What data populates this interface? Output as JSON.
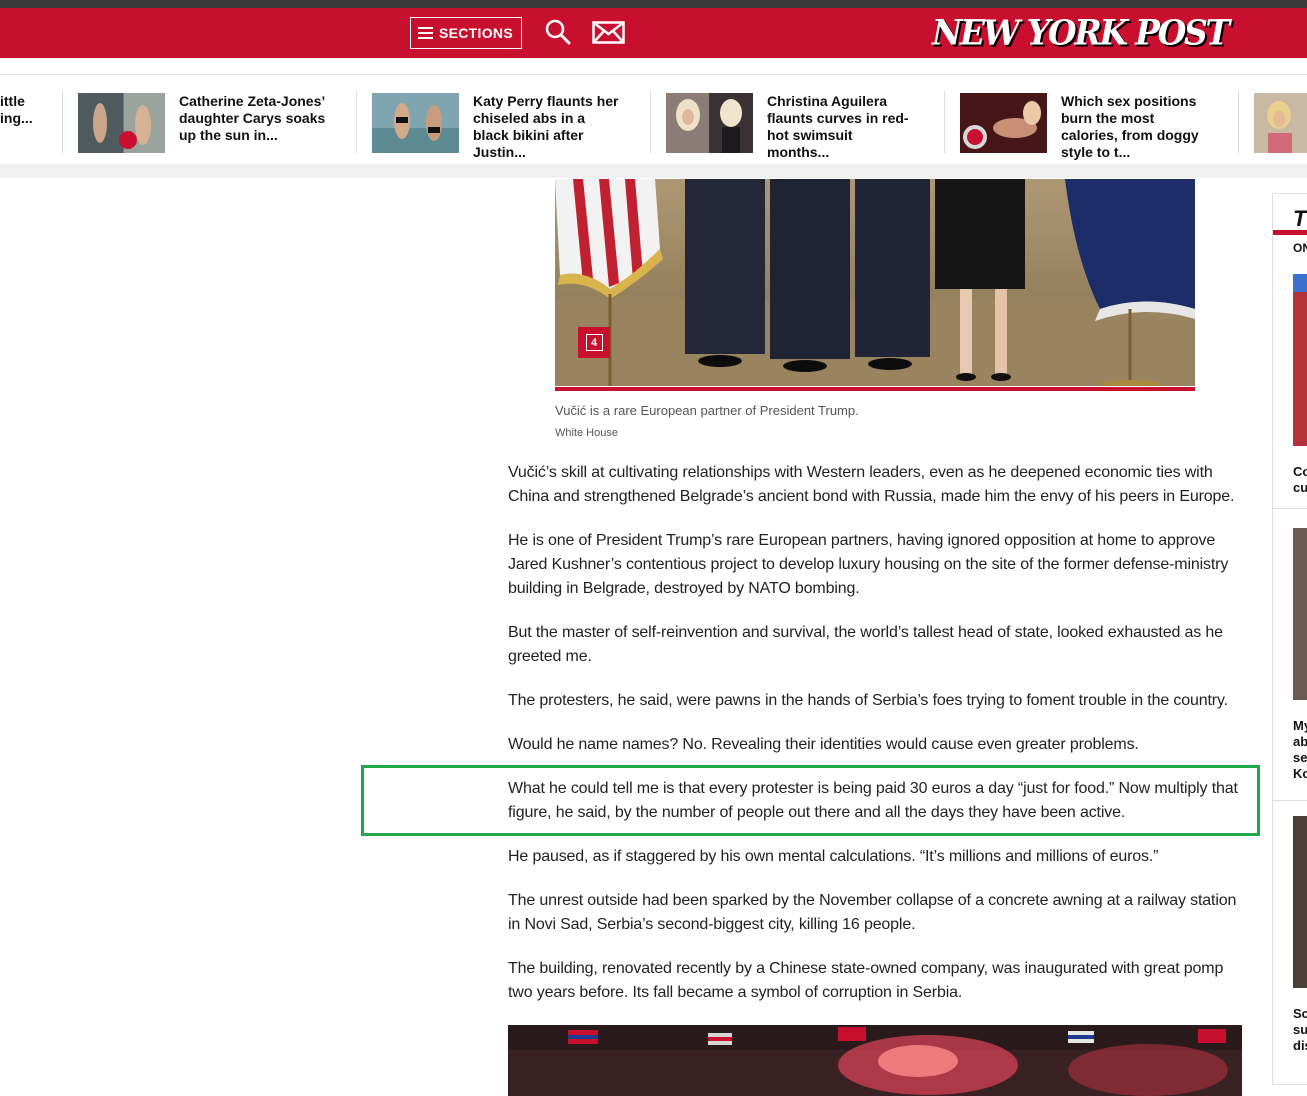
{
  "nav": {
    "sections_label": "SECTIONS",
    "logo_text": "NEW YORK POST",
    "brand_color": "#c8102e",
    "icons": [
      "menu-icon",
      "search-icon",
      "mail-icon"
    ]
  },
  "trending": [
    {
      "title": "ittle\ning..."
    },
    {
      "title": "Catherine Zeta-Jones’ daughter Carys soaks up the sun in..."
    },
    {
      "title": "Katy Perry flaunts her chiseled abs in a black bikini after Justin..."
    },
    {
      "title": "Christina Aguilera flaunts curves in red-hot swimsuit months..."
    },
    {
      "title": "Which sex positions burn the most calories, from doggy style to t..."
    }
  ],
  "article": {
    "gallery_count": "4",
    "caption": "Vučić is a rare European partner of President Trump.",
    "credit": "White House",
    "paragraphs": [
      "Vučić’s skill at cultivating relationships with Western leaders, even as he deepened economic ties with China and strengthened Belgrade’s ancient bond with Russia, made him the envy of his peers in Europe.",
      "He is one of President Trump’s rare European partners, having ignored opposition at home to approve Jared Kushner’s contentious project to develop luxury housing on the site of the former defense-ministry building in Belgrade, destroyed by NATO bombing.",
      "But the master of self-reinvention and survival, the world’s tallest head of state, looked exhausted as he greeted me.",
      "The protesters, he said, were pawns in the hands of Serbia’s foes trying to foment trouble in the country.",
      "Would he name names? No. Revealing their identities would cause even greater problems.",
      "What he could tell me is that every protester is being paid 30 euros a day “just for food.” Now multiply that figure, he said, by the number of people out there and all the days they have been active.",
      "He paused, as if staggered by his own mental calculations. “It’s millions and millions of euros.”",
      "The unrest outside had been sparked by the November collapse of a concrete awning at a railway station in Novi Sad, Serbia’s second-biggest city, killing 16 people.",
      "The building, renovated recently by a Chinese state-owned company, was inaugurated with great pomp two years before. Its fall became a symbol of corruption in Serbia."
    ],
    "highlight_color": "#22a84a"
  },
  "sidebar": {
    "heading": "T",
    "subheading": "ON",
    "snippets": [
      "Co\ncu",
      "My\nab\nse\nKo",
      "Sc\nsu\ndis"
    ]
  }
}
